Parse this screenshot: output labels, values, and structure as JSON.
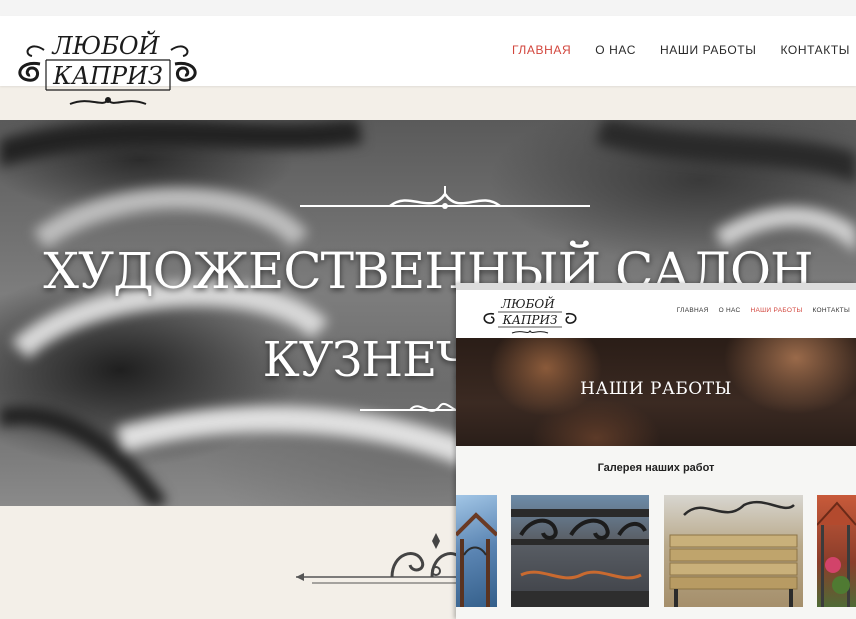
{
  "site": {
    "logo_text_top": "ЛЮБОЙ",
    "logo_text_bottom": "КАПРИЗ",
    "nav": [
      {
        "label": "ГЛАВНАЯ",
        "active": true
      },
      {
        "label": "О НАС",
        "active": false
      },
      {
        "label": "НАШИ РАБОТЫ",
        "active": false
      },
      {
        "label": "КОНТАКТЫ",
        "active": false
      }
    ],
    "accent_color": "#d2453c"
  },
  "hero": {
    "line1": "ХУДОЖЕСТВЕННЫЙ САЛОН",
    "line2": "КУЗНЕЧНЫЕ"
  },
  "preview": {
    "logo_text_top": "ЛЮБОЙ",
    "logo_text_bottom": "КАПРИЗ",
    "nav": [
      {
        "label": "ГЛАВНАЯ",
        "active": false
      },
      {
        "label": "О НАС",
        "active": false
      },
      {
        "label": "НАШИ РАБОТЫ",
        "active": true
      },
      {
        "label": "КОНТАКТЫ",
        "active": false
      }
    ],
    "banner_title": "НАШИ РАБОТЫ",
    "gallery_title": "Галерея наших работ",
    "thumbnails": [
      "gazebo-photo",
      "forged-railing-photo",
      "forged-bench-photo",
      "garden-arch-photo"
    ]
  }
}
